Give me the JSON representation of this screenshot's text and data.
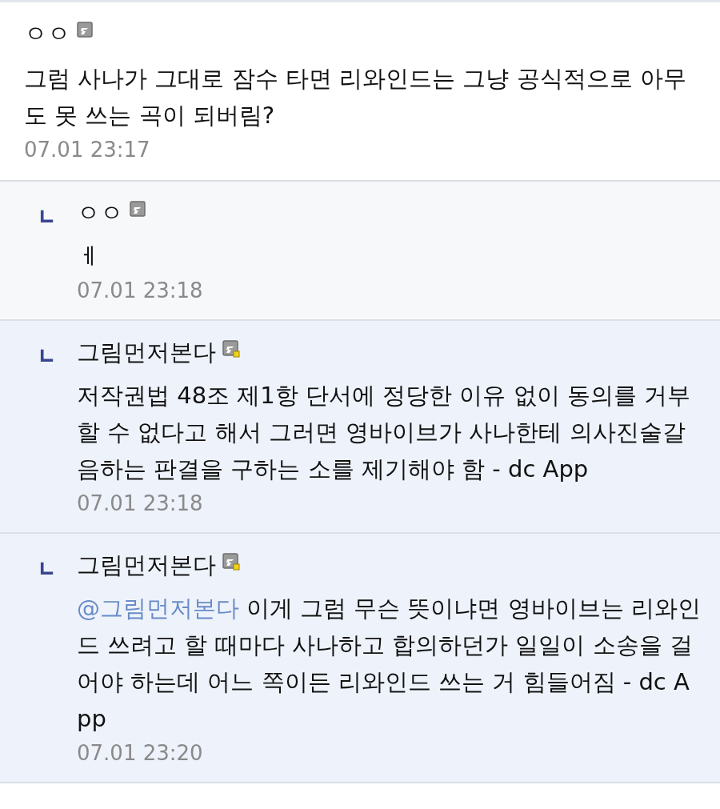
{
  "comments": [
    {
      "kind": "comment",
      "author": "ㅇㅇ",
      "badge_dot": false,
      "text": "그럼 사나가 그대로 잠수 타면 리와인드는 그냥 공식적으로 아무도 못 쓰는 곡이 되버림?",
      "time": "07.01 23:17"
    },
    {
      "kind": "reply",
      "author": "ㅇㅇ",
      "badge_dot": false,
      "text": "ㅔ",
      "time": "07.01 23:18"
    },
    {
      "kind": "tinted_reply",
      "author": "그림먼저본다",
      "badge_dot": true,
      "text": "저작권법 48조 제1항 단서에 정당한 이유 없이 동의를 거부할 수 없다고 해서 그러면 영바이브가 사나한테 의사진술갈음하는 판결을 구하는 소를 제기해야 함 - dc App",
      "time": "07.01 23:18"
    },
    {
      "kind": "tinted_reply",
      "author": "그림먼저본다",
      "badge_dot": true,
      "mention": "@그림먼저본다",
      "text": "이게 그럼 무슨 뜻이냐면 영바이브는 리와인드 쓰려고 할 때마다 사나하고 합의하던가 일일이 소송을 걸어야 하는데 어느 쪽이든 리와인드 쓰는 거 힘들어짐 - dc App",
      "time": "07.01 23:20"
    }
  ]
}
